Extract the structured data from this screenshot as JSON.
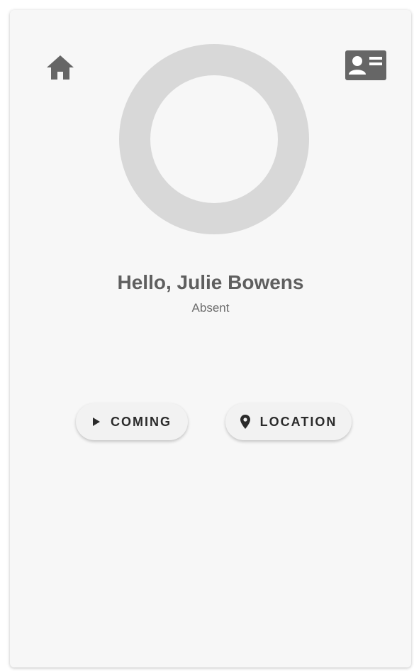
{
  "header": {
    "home_icon": "home-icon",
    "profile_card_icon": "id-card-icon"
  },
  "profile": {
    "greeting": "Hello, Julie Bowens",
    "status": "Absent"
  },
  "actions": {
    "coming_label": "COMING",
    "coming_icon": "play-icon",
    "location_label": "LOCATION",
    "location_icon": "location-pin-icon"
  },
  "colors": {
    "icon": "#666666",
    "ring": "#d8d8d8",
    "card_background": "#f7f7f7",
    "button_text": "#2b2b2b"
  }
}
